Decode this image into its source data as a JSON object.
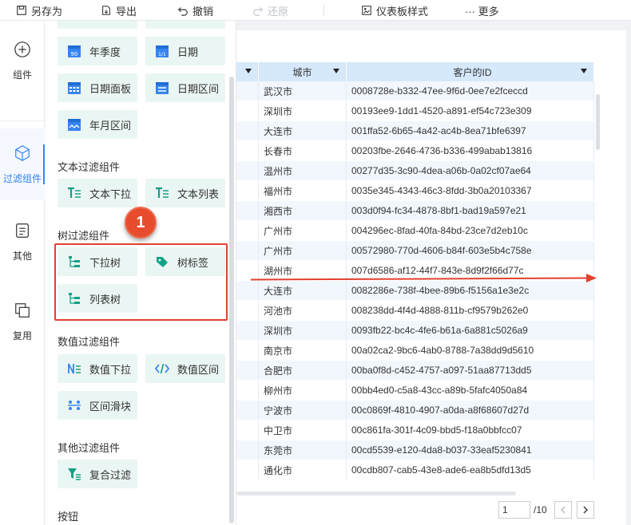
{
  "toolbar": {
    "save_as": "另存为",
    "export": "导出",
    "undo": "撤销",
    "redo": "还原",
    "dashboard_style": "仪表板样式",
    "more": "··· 更多"
  },
  "rail": {
    "components": "组件",
    "filter_components": "过滤组件",
    "other": "其他",
    "reuse": "复用"
  },
  "panel": {
    "date_items": [
      "年季度",
      "日期",
      "日期面板",
      "日期区间",
      "年月区间"
    ],
    "text_group": "文本过滤组件",
    "text_items": [
      "文本下拉",
      "文本列表"
    ],
    "tree_group": "树过滤组件",
    "tree_items": [
      "下拉树",
      "树标签",
      "列表树"
    ],
    "number_group": "数值过滤组件",
    "number_items": [
      "数值下拉",
      "数值区间",
      "区间滑块"
    ],
    "other_group": "其他过滤组件",
    "other_items": [
      "复合过滤"
    ],
    "button_group": "按钮"
  },
  "table": {
    "columns": [
      "",
      "城市",
      "客户的ID"
    ],
    "rows": [
      [
        "武汉市",
        "0008728e-b332-47ee-9f6d-0ee7e2fceccd"
      ],
      [
        "深圳市",
        "00193ee9-1dd1-4520-a891-ef54c723e309"
      ],
      [
        "大连市",
        "001ffa52-6b65-4a42-ac4b-8ea71bfe6397"
      ],
      [
        "长春市",
        "00203fbe-2646-4736-b336-499abab13816"
      ],
      [
        "温州市",
        "00277d35-3c90-4dea-a06b-0a02cf07ae64"
      ],
      [
        "福州市",
        "0035e345-4343-46c3-8fdd-3b0a20103367"
      ],
      [
        "湘西市",
        "003d0f94-fc34-4878-8bf1-bad19a597e21"
      ],
      [
        "广州市",
        "004296ec-8fad-40fa-84bd-23ce7d2eb10c"
      ],
      [
        "广州市",
        "00572980-770d-4606-b84f-603e5b4c758e"
      ],
      [
        "湖州市",
        "007d6586-af12-44f7-843e-8d9f2f66d77c"
      ],
      [
        "大连市",
        "0082286e-738f-4bee-89b6-f5156a1e3e2c"
      ],
      [
        "河池市",
        "008238dd-4f4d-4888-811b-cf9579b262e0"
      ],
      [
        "深圳市",
        "0093fb22-bc4c-4fe6-b61a-6a881c5026a9"
      ],
      [
        "南京市",
        "00a02ca2-9bc6-4ab0-8788-7a38dd9d5610"
      ],
      [
        "合肥市",
        "00ba0f8d-c452-4757-a097-51aa87713dd5"
      ],
      [
        "柳州市",
        "00bb4ed0-c5a8-43cc-a89b-5fafc4050a84"
      ],
      [
        "宁波市",
        "00c0869f-4810-4907-a0da-a8f68607d27d"
      ],
      [
        "中卫市",
        "00c861fa-301f-4c09-bbd5-f18a0bbfcc07"
      ],
      [
        "东莞市",
        "00cd5539-e120-4da8-b037-33eaf5230841"
      ],
      [
        "通化市",
        "00cdb807-cab5-43e8-ade6-ea8b5dfd13d5"
      ]
    ]
  },
  "pager": {
    "current": "1",
    "total": "/10"
  },
  "annotation": {
    "step": "1"
  },
  "colors": {
    "accent": "#3685f2",
    "component_bg": "#eaf6f3",
    "icon_blue": "#3685f2",
    "icon_teal": "#14a085",
    "header_bg": "#d6e8fb",
    "highlight": "#e2412f"
  }
}
